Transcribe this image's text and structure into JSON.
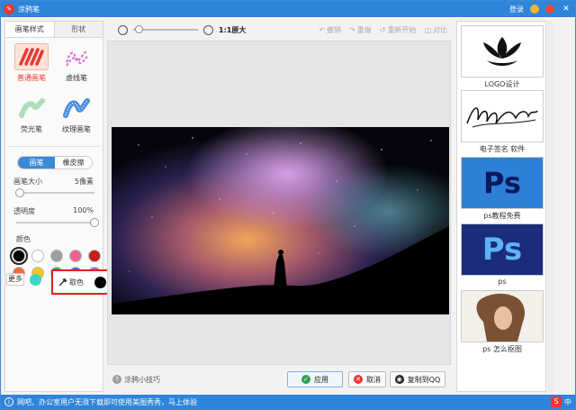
{
  "window": {
    "title": "涂鸦笔",
    "login": "登录"
  },
  "left": {
    "tabs": [
      "画笔样式",
      "形状"
    ],
    "brushes": [
      {
        "label": "普通画笔",
        "color": "#e53935"
      },
      {
        "label": "虚线笔",
        "color": "#d86ad0"
      },
      {
        "label": "荧光笔",
        "color": "#8fd19e"
      },
      {
        "label": "纹理画笔",
        "color": "#4a8be0"
      }
    ],
    "modes": [
      "画笔",
      "橡皮擦"
    ],
    "size_label": "画笔大小",
    "size_value": "5像素",
    "opacity_label": "透明度",
    "opacity_value": "100%",
    "color_label": "颜色",
    "palette": [
      "#000000",
      "#ffffff",
      "#9e9e9e",
      "#f0648a",
      "#c81e1e",
      "#f06a3c",
      "#f4c620",
      "#25a84a",
      "#3d66d6",
      "#a45ee0"
    ],
    "more_label": "更多",
    "more_color": "#3ed3c8",
    "picker_label": "取色",
    "picker_color": "#000000",
    "brush_size_level": 0.05,
    "opacity_level": 1.0
  },
  "center": {
    "zoom_text": "1:1原大",
    "actions": [
      "撤销",
      "重做",
      "重新开始",
      "对比"
    ],
    "tips": "涂鸦小技巧",
    "buttons": {
      "apply": "应用",
      "cancel": "取消",
      "copy": "复制到QQ"
    },
    "zoom_level": 0.02
  },
  "right": {
    "items": [
      {
        "caption": "LOGO设计"
      },
      {
        "caption": "电子签名 软件"
      },
      {
        "caption": "ps教程免费"
      },
      {
        "caption": "ps"
      },
      {
        "caption": "ps 怎么抠图"
      }
    ]
  },
  "status": {
    "text": "网吧、办公室用户无须下载即可使用美图秀秀，马上体验",
    "ime_logo": "S",
    "ime_text": "中"
  }
}
